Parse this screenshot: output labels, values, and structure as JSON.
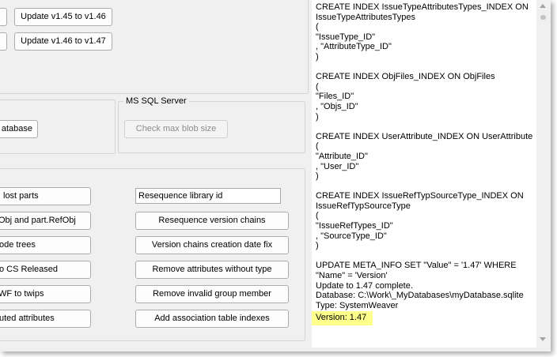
{
  "update_group": {
    "buttons": [
      "Update v1.45 to v1.46",
      "Update v1.46 to v1.47"
    ]
  },
  "db_group": {
    "button_label": "atabase"
  },
  "mssql_group": {
    "title": "MS SQL Server",
    "button_label": "Check max blob size",
    "button_enabled": false
  },
  "tools_group": {
    "left_buttons": [
      "lost parts",
      "Obj and part.RefObj",
      "ode trees",
      "o CS Released",
      "WF to twips",
      "uted attributes"
    ],
    "resequence_input": {
      "value": "Resequence library id"
    },
    "right_buttons": [
      "Resequence version chains",
      "Version chains creation date fix",
      "Remove attributes without type",
      "Remove invalid group member",
      "Add association table indexes"
    ]
  },
  "log": {
    "lines": [
      "CREATE INDEX IssueTypeAttributesTypes_INDEX ON",
      "IssueTypeAttributesTypes",
      "(",
      "\"IssueType_ID\"",
      ", \"AttributeType_ID\"",
      ")",
      "",
      "CREATE INDEX ObjFiles_INDEX ON ObjFiles",
      "(",
      "\"Files_ID\"",
      ", \"Objs_ID\"",
      ")",
      "",
      "CREATE INDEX UserAttribute_INDEX ON UserAttribute",
      "(",
      "\"Attribute_ID\"",
      ", \"User_ID\"",
      ")",
      "",
      "CREATE INDEX IssueRefTypSourceType_INDEX ON",
      "IssueRefTypSourceType",
      "(",
      "\"IssueRefTypes_ID\"",
      ", \"SourceType_ID\"",
      ")",
      "",
      "UPDATE META_INFO SET \"Value\" = '1.47' WHERE",
      "\"Name\" = 'Version'",
      "Update to 1.47 complete.",
      "Database: C:\\Work\\_MyDatabases\\myDatabase.sqlite",
      "Type: SystemWeaver"
    ],
    "highlighted_line": "Version: 1.47",
    "highlight_color": "#ffff8c"
  },
  "colors": {
    "window_bg": "#f0f0f0",
    "log_bg": "#ffffff",
    "highlight": "#ffff8c"
  }
}
